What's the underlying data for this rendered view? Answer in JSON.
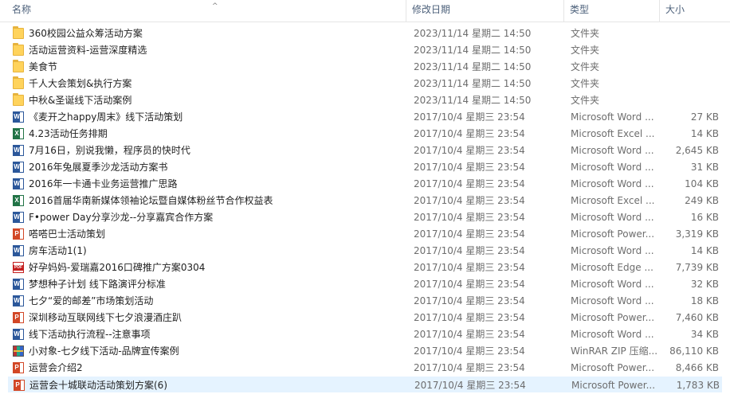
{
  "columns": {
    "name": "名称",
    "date": "修改日期",
    "type": "类型",
    "size": "大小"
  },
  "files": [
    {
      "name": "360校园公益众筹活动方案",
      "date": "2023/11/14 星期二 14:50",
      "type": "文件夹",
      "size": "",
      "icon": "folder-icon"
    },
    {
      "name": "活动运营资料-运营深度精选",
      "date": "2023/11/14 星期二 14:50",
      "type": "文件夹",
      "size": "",
      "icon": "folder-icon"
    },
    {
      "name": "美食节",
      "date": "2023/11/14 星期二 14:50",
      "type": "文件夹",
      "size": "",
      "icon": "folder-icon"
    },
    {
      "name": "千人大会策划&执行方案",
      "date": "2023/11/14 星期二 14:50",
      "type": "文件夹",
      "size": "",
      "icon": "folder-icon"
    },
    {
      "name": "中秋&圣诞线下活动案例",
      "date": "2023/11/14 星期二 14:50",
      "type": "文件夹",
      "size": "",
      "icon": "folder-icon"
    },
    {
      "name": "《麦开之happy周末》线下活动策划",
      "date": "2017/10/4 星期三 23:54",
      "type": "Microsoft Word ...",
      "size": "27 KB",
      "icon": "word-icon"
    },
    {
      "name": "4.23活动任务排期",
      "date": "2017/10/4 星期三 23:54",
      "type": "Microsoft Excel ...",
      "size": "14 KB",
      "icon": "excel-icon"
    },
    {
      "name": "7月16日，别说我懒，程序员的快时代",
      "date": "2017/10/4 星期三 23:54",
      "type": "Microsoft Word ...",
      "size": "2,645 KB",
      "icon": "word-icon"
    },
    {
      "name": "2016年兔展夏季沙龙活动方案书",
      "date": "2017/10/4 星期三 23:54",
      "type": "Microsoft Word ...",
      "size": "31 KB",
      "icon": "word-icon"
    },
    {
      "name": "2016年一卡通卡业务运营推广思路",
      "date": "2017/10/4 星期三 23:54",
      "type": "Microsoft Word ...",
      "size": "104 KB",
      "icon": "word-icon"
    },
    {
      "name": "2016首届华南新媒体领袖论坛暨自媒体粉丝节合作权益表",
      "date": "2017/10/4 星期三 23:54",
      "type": "Microsoft Excel ...",
      "size": "249 KB",
      "icon": "excel-icon"
    },
    {
      "name": "F•power Day分享沙龙--分享嘉宾合作方案",
      "date": "2017/10/4 星期三 23:54",
      "type": "Microsoft Word ...",
      "size": "16 KB",
      "icon": "word-icon"
    },
    {
      "name": "嗒嗒巴士活动策划",
      "date": "2017/10/4 星期三 23:54",
      "type": "Microsoft Power...",
      "size": "3,319 KB",
      "icon": "ppt-icon"
    },
    {
      "name": "房车活动1(1)",
      "date": "2017/10/4 星期三 23:54",
      "type": "Microsoft Word ...",
      "size": "14 KB",
      "icon": "word-icon"
    },
    {
      "name": "好孕妈妈-爱瑞嘉2016口碑推广方案0304",
      "date": "2017/10/4 星期三 23:54",
      "type": "Microsoft Edge ...",
      "size": "7,739 KB",
      "icon": "pdf-icon"
    },
    {
      "name": "梦想种子计划 线下路演评分标准",
      "date": "2017/10/4 星期三 23:54",
      "type": "Microsoft Word ...",
      "size": "32 KB",
      "icon": "word-icon"
    },
    {
      "name": "七夕“爱的邮差”市场策划活动",
      "date": "2017/10/4 星期三 23:54",
      "type": "Microsoft Word ...",
      "size": "18 KB",
      "icon": "word-icon"
    },
    {
      "name": "深圳移动互联网线下七夕浪漫酒庄趴",
      "date": "2017/10/4 星期三 23:54",
      "type": "Microsoft Power...",
      "size": "7,460 KB",
      "icon": "ppt-icon"
    },
    {
      "name": "线下活动执行流程--注意事项",
      "date": "2017/10/4 星期三 23:54",
      "type": "Microsoft Word ...",
      "size": "34 KB",
      "icon": "word-icon"
    },
    {
      "name": "小对象-七夕线下活动-品牌宣传案例",
      "date": "2017/10/4 星期三 23:54",
      "type": "WinRAR ZIP 压缩...",
      "size": "86,110 KB",
      "icon": "rar-icon"
    },
    {
      "name": "运营会介绍2",
      "date": "2017/10/4 星期三 23:54",
      "type": "Microsoft Power...",
      "size": "8,466 KB",
      "icon": "ppt-icon"
    },
    {
      "name": "运营会十城联动活动策划方案(6)",
      "date": "2017/10/4 星期三 23:54",
      "type": "Microsoft Power...",
      "size": "1,783 KB",
      "icon": "ppt-icon"
    }
  ]
}
